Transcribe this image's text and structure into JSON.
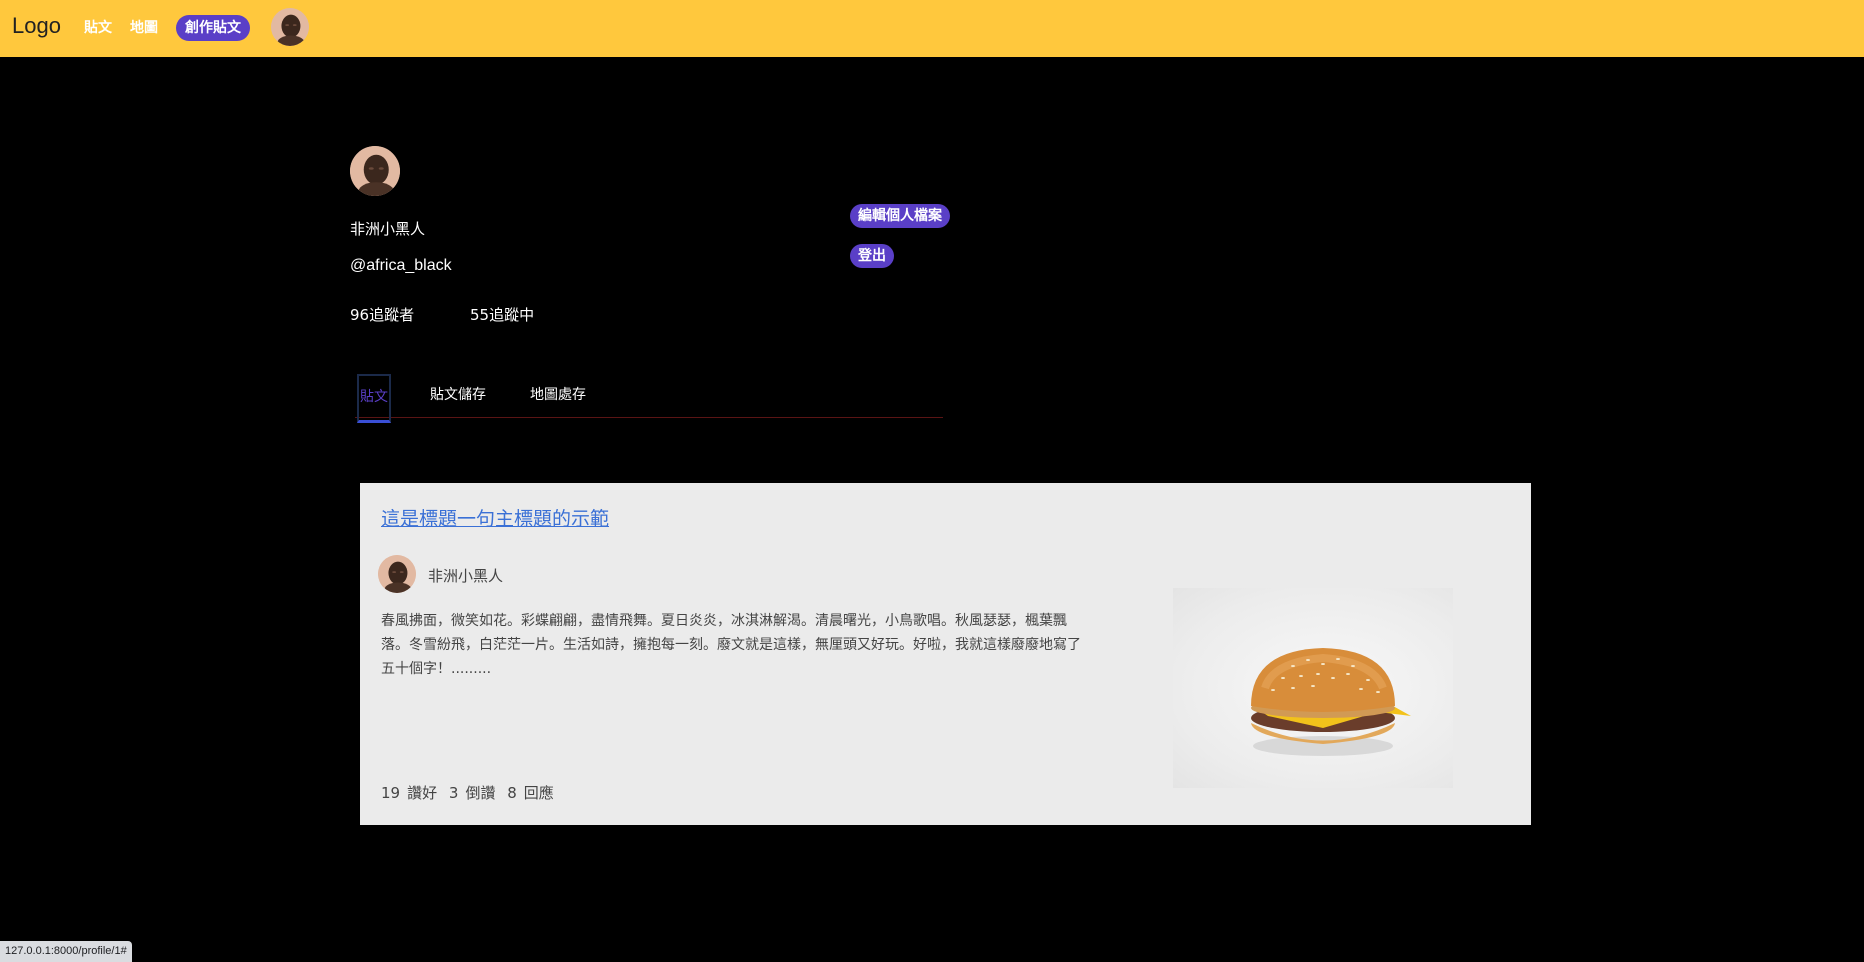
{
  "header": {
    "logo": "Logo",
    "nav": [
      "貼文",
      "地圖"
    ],
    "create_label": "創作貼文",
    "accent": "#ffc83d",
    "button_color": "#5a3fc7"
  },
  "profile": {
    "name": "非洲小黑人",
    "handle": "@africa_black",
    "followers": "96追蹤者",
    "following": "55追蹤中",
    "edit_label": "編輯個人檔案",
    "logout_label": "登出"
  },
  "tabs": [
    "貼文",
    "貼文儲存",
    "地圖處存"
  ],
  "post": {
    "title": "這是標題一句主標題的示範",
    "author": "非洲小黑人",
    "body": "春風拂面，微笑如花。彩蝶翩翩，盡情飛舞。夏日炎炎，冰淇淋解渴。清晨曙光，小鳥歌唱。秋風瑟瑟，楓葉飄落。冬雪紛飛，白茫茫一片。生活如詩，擁抱每一刻。廢文就是這樣，無厘頭又好玩。好啦，我就這樣廢廢地寫了五十個字！.........",
    "likes": "19",
    "likes_label": "讚好",
    "dislikes": "3",
    "dislikes_label": "倒讚",
    "replies": "8",
    "replies_label": "回應"
  },
  "status_bar": {
    "url": "127.0.0.1:8000/profile/1#"
  }
}
